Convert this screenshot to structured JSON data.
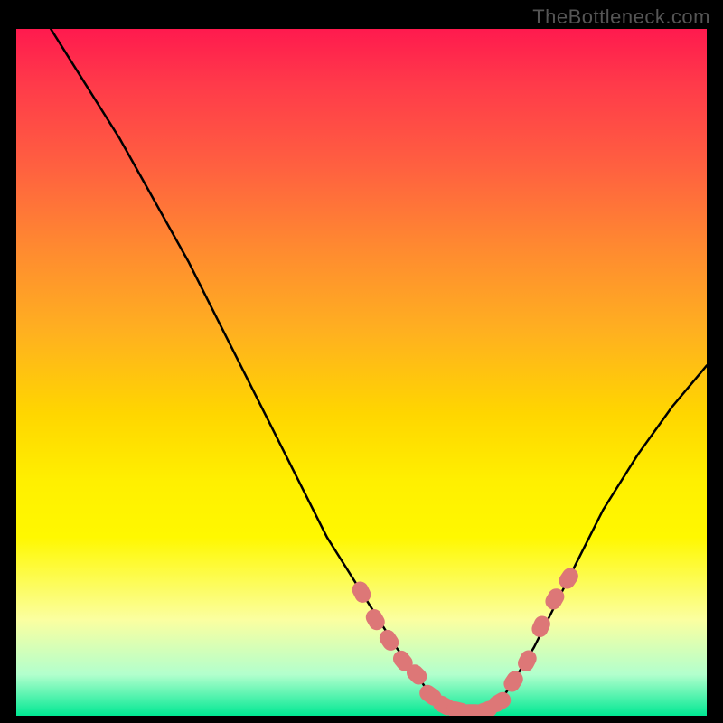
{
  "watermark": "TheBottleneck.com",
  "chart_data": {
    "type": "line",
    "title": "",
    "xlabel": "",
    "ylabel": "",
    "xlim": [
      0,
      100
    ],
    "ylim": [
      0,
      100
    ],
    "grid": false,
    "series": [
      {
        "name": "curve",
        "color": "#000000",
        "x": [
          5,
          10,
          15,
          20,
          25,
          30,
          35,
          40,
          45,
          50,
          55,
          58,
          60,
          62,
          64,
          66,
          68,
          70,
          72,
          75,
          80,
          85,
          90,
          95,
          100
        ],
        "y": [
          100,
          92,
          84,
          75,
          66,
          56,
          46,
          36,
          26,
          18,
          10,
          6,
          3,
          1.5,
          0.8,
          0.5,
          0.8,
          2,
          5,
          10,
          20,
          30,
          38,
          45,
          51
        ]
      }
    ],
    "valley_markers": {
      "color": "#dd7777",
      "left_segment": {
        "x": [
          50,
          52,
          54,
          56,
          58
        ],
        "y": [
          18,
          14,
          11,
          8,
          6
        ]
      },
      "bottom_segment": {
        "x": [
          60,
          62,
          64,
          66,
          68,
          70
        ],
        "y": [
          3,
          1.5,
          0.8,
          0.5,
          0.8,
          2
        ]
      },
      "right_segment": {
        "x": [
          72,
          74,
          76,
          78,
          80
        ],
        "y": [
          5,
          8,
          13,
          17,
          20
        ]
      }
    },
    "green_floor_band": {
      "ymin": 0,
      "ymax": 3.5
    }
  }
}
